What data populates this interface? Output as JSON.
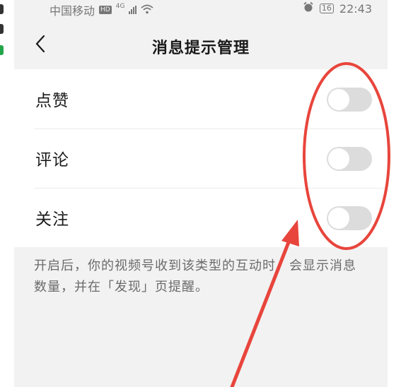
{
  "status_bar": {
    "carrier": "中国移动",
    "hd_badge": "HD",
    "network": "4G",
    "battery": "16",
    "time": "22:43"
  },
  "nav": {
    "title": "消息提示管理"
  },
  "settings": [
    {
      "label": "点赞",
      "enabled": false
    },
    {
      "label": "评论",
      "enabled": false
    },
    {
      "label": "关注",
      "enabled": false
    }
  ],
  "description": "开启后，你的视频号收到该类型的互动时，会显示消息数量，并在「发现」页提醒。",
  "icons": {
    "back": "chevron-left-icon",
    "alarm": "alarm-icon",
    "wifi": "wifi-icon",
    "signal": "signal-icon",
    "battery": "battery-icon"
  },
  "colors": {
    "annotation": "#e8453c",
    "toggle_off": "#dcdcdc",
    "background": "#f2f2f2"
  }
}
